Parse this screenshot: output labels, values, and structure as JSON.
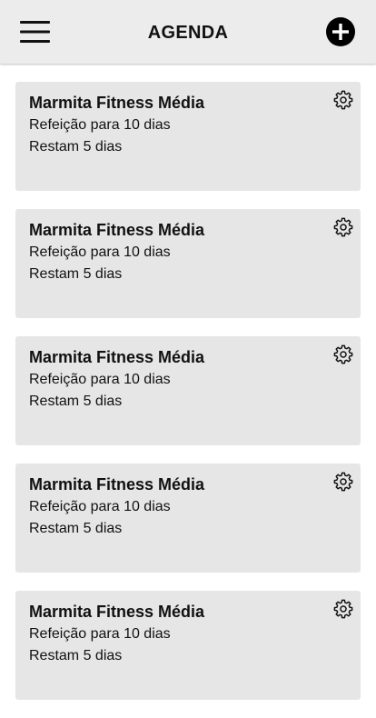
{
  "header": {
    "title": "AGENDA",
    "menu_icon": "hamburger-menu-icon",
    "add_icon": "plus-circle-icon"
  },
  "colors": {
    "header_bg": "#ececec",
    "card_bg": "#e6e6e6",
    "text": "#111111"
  },
  "cards": [
    {
      "title": "Marmita Fitness Média",
      "meals": "Refeição para 10 dias",
      "remaining": "Restam 5 dias",
      "icon": "gear-icon"
    },
    {
      "title": "Marmita Fitness Média",
      "meals": "Refeição para 10 dias",
      "remaining": "Restam 5 dias",
      "icon": "gear-icon"
    },
    {
      "title": "Marmita Fitness Média",
      "meals": "Refeição para 10 dias",
      "remaining": "Restam 5 dias",
      "icon": "gear-icon"
    },
    {
      "title": "Marmita Fitness Média",
      "meals": "Refeição para 10 dias",
      "remaining": "Restam 5 dias",
      "icon": "gear-icon"
    },
    {
      "title": "Marmita Fitness Média",
      "meals": "Refeição para 10 dias",
      "remaining": "Restam 5 dias",
      "icon": "gear-icon"
    }
  ]
}
